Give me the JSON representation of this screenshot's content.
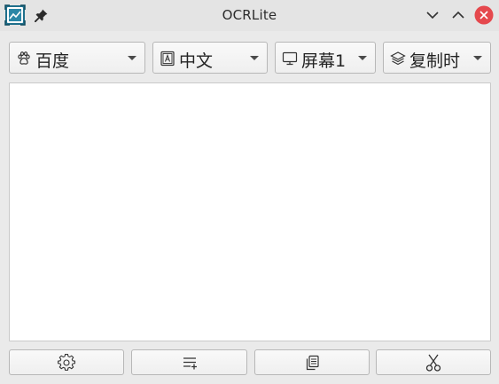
{
  "window": {
    "title": "OCRLite",
    "app_icon": "image-scan-icon",
    "pin_icon": "pin-icon",
    "controls": [
      "minimize-icon",
      "maximize-icon",
      "close-icon"
    ],
    "close_color": "#e5484d"
  },
  "toolbar": {
    "engine": {
      "icon": "paw-icon",
      "label": "百度"
    },
    "language": {
      "icon": "text-page-icon",
      "label": "中文"
    },
    "screen": {
      "icon": "monitor-icon",
      "label": "屏幕1"
    },
    "copy_mode": {
      "icon": "layers-icon",
      "label": "复制时"
    }
  },
  "result": {
    "text": ""
  },
  "bottom_buttons": [
    {
      "icon": "gear-icon"
    },
    {
      "icon": "append-list-icon"
    },
    {
      "icon": "copy-icon"
    },
    {
      "icon": "scissors-icon"
    }
  ]
}
